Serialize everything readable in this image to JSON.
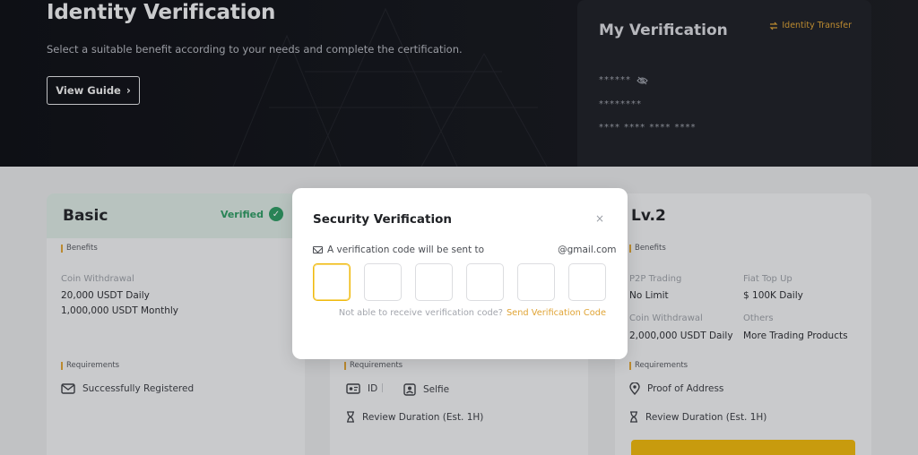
{
  "hero": {
    "title": "Identity Verification",
    "subtitle": "Select a suitable benefit according to your needs and complete the certification.",
    "guide_label": "View Guide",
    "guide_chevron": "›"
  },
  "my_verification": {
    "title": "My Verification",
    "transfer_label": "Identity Transfer",
    "masked_name": "******",
    "masked_id": "********",
    "masked_number": "**** **** **** ****"
  },
  "cards": {
    "basic": {
      "title": "Basic",
      "status": "Verified",
      "benefits_label": "Benefits",
      "coin_withdrawal_label": "Coin Withdrawal",
      "daily_limit": "20,000 USDT Daily",
      "monthly_limit": "1,000,000 USDT Monthly",
      "requirements_label": "Requirements",
      "requirement_1": "Successfully Registered"
    },
    "lv1": {
      "requirements_label": "Requirements",
      "req_id": "ID",
      "req_selfie": "Selfie",
      "review_duration": "Review Duration (Est. 1H)"
    },
    "lv2": {
      "title": "Lv.2",
      "benefits_label": "Benefits",
      "p2p_label": "P2P Trading",
      "p2p_value": "No Limit",
      "fiat_label": "Fiat Top Up",
      "fiat_value": "$ 100K Daily",
      "coin_withdrawal_label": "Coin Withdrawal",
      "coin_withdrawal_value": "2,000,000 USDT Daily",
      "others_label": "Others",
      "others_value": "More Trading Products",
      "requirements_label": "Requirements",
      "req_address": "Proof of Address",
      "review_duration": "Review Duration (Est. 1H)"
    }
  },
  "modal": {
    "title": "Security Verification",
    "close_glyph": "×",
    "info_prefix": "A verification code will be sent to",
    "email_suffix": "@gmail.com",
    "code_length": 6,
    "resend_question": "Not able to receive verification code?",
    "resend_link": "Send Verification Code"
  },
  "colors": {
    "accent": "#f0b90b",
    "link": "#e0a435",
    "success": "#2e9c63",
    "hero_bg": "#0d0f14"
  }
}
